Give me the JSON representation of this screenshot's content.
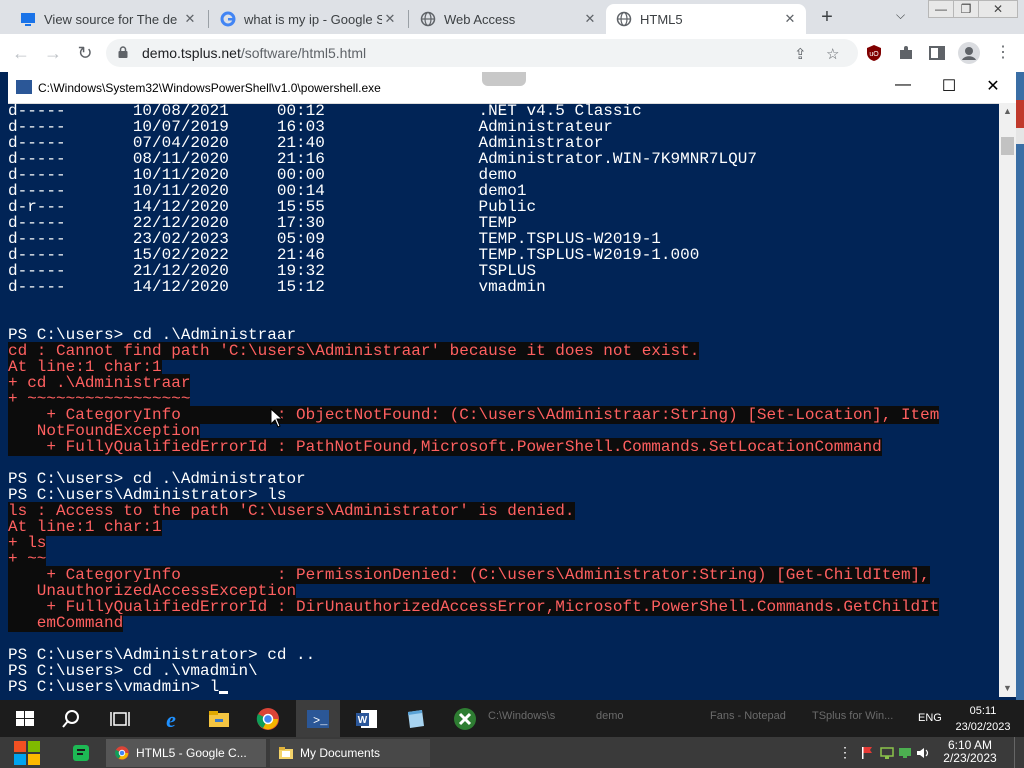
{
  "browser": {
    "tabs": [
      {
        "title": "View source for The de",
        "icon": "monitor-icon"
      },
      {
        "title": "what is my ip - Google S",
        "icon": "google-icon"
      },
      {
        "title": "Web Access",
        "icon": "globe-icon"
      },
      {
        "title": "HTML5",
        "icon": "globe-icon",
        "active": true
      }
    ],
    "url_host": "demo.tsplus.net",
    "url_path": "/software/html5.html"
  },
  "console": {
    "title": "C:\\Windows\\System32\\WindowsPowerShell\\v1.0\\powershell.exe",
    "lines": [
      {
        "t": "d-----       10/08/2021     00:12                .NET v4.5 Classic",
        "e": false
      },
      {
        "t": "d-----       10/07/2019     16:03                Administrateur",
        "e": false
      },
      {
        "t": "d-----       07/04/2020     21:40                Administrator",
        "e": false
      },
      {
        "t": "d-----       08/11/2020     21:16                Administrator.WIN-7K9MNR7LQU7",
        "e": false
      },
      {
        "t": "d-----       10/11/2020     00:00                demo",
        "e": false
      },
      {
        "t": "d-----       10/11/2020     00:14                demo1",
        "e": false
      },
      {
        "t": "d-r---       14/12/2020     15:55                Public",
        "e": false
      },
      {
        "t": "d-----       22/12/2020     17:30                TEMP",
        "e": false
      },
      {
        "t": "d-----       23/02/2023     05:09                TEMP.TSPLUS-W2019-1",
        "e": false
      },
      {
        "t": "d-----       15/02/2022     21:46                TEMP.TSPLUS-W2019-1.000",
        "e": false
      },
      {
        "t": "d-----       21/12/2020     19:32                TSPLUS",
        "e": false
      },
      {
        "t": "d-----       14/12/2020     15:12                vmadmin",
        "e": false
      },
      {
        "t": "",
        "e": false
      },
      {
        "t": "",
        "e": false
      },
      {
        "t": "PS C:\\users> cd .\\Administraar",
        "e": false
      },
      {
        "t": "cd : Cannot find path 'C:\\users\\Administraar' because it does not exist.",
        "e": true
      },
      {
        "t": "At line:1 char:1",
        "e": true
      },
      {
        "t": "+ cd .\\Administraar",
        "e": true
      },
      {
        "t": "+ ~~~~~~~~~~~~~~~~~",
        "e": true
      },
      {
        "t": "    + CategoryInfo          : ObjectNotFound: (C:\\users\\Administraar:String) [Set-Location], Item",
        "e": true
      },
      {
        "t": "   NotFoundException",
        "e": true
      },
      {
        "t": "    + FullyQualifiedErrorId : PathNotFound,Microsoft.PowerShell.Commands.SetLocationCommand",
        "e": true
      },
      {
        "t": "",
        "e": false
      },
      {
        "t": "PS C:\\users> cd .\\Administrator",
        "e": false
      },
      {
        "t": "PS C:\\users\\Administrator> ls",
        "e": false
      },
      {
        "t": "ls : Access to the path 'C:\\users\\Administrator' is denied.",
        "e": true
      },
      {
        "t": "At line:1 char:1",
        "e": true
      },
      {
        "t": "+ ls",
        "e": true
      },
      {
        "t": "+ ~~",
        "e": true
      },
      {
        "t": "    + CategoryInfo          : PermissionDenied: (C:\\users\\Administrator:String) [Get-ChildItem],",
        "e": true
      },
      {
        "t": "   UnauthorizedAccessException",
        "e": true
      },
      {
        "t": "    + FullyQualifiedErrorId : DirUnauthorizedAccessError,Microsoft.PowerShell.Commands.GetChildIt",
        "e": true
      },
      {
        "t": "   emCommand",
        "e": true
      },
      {
        "t": "",
        "e": false
      },
      {
        "t": "PS C:\\users\\Administrator> cd ..",
        "e": false
      },
      {
        "t": "PS C:\\users> cd .\\vmadmin\\",
        "e": false
      },
      {
        "t": "PS C:\\users\\vmadmin> l",
        "e": false
      }
    ]
  },
  "remote_taskbar": {
    "lang": "ENG",
    "time": "05:11",
    "date": "23/02/2023",
    "ghost_items": [
      "C:\\Windows\\s",
      "demo",
      "Fans - Notepad",
      "TSplus for Win..."
    ]
  },
  "local_taskbar": {
    "items": [
      {
        "label": "HTML5 - Google C...",
        "icon": "chrome-icon"
      },
      {
        "label": "My Documents",
        "icon": "folder-icon"
      }
    ],
    "time": "6:10 AM",
    "date": "2/23/2023"
  }
}
